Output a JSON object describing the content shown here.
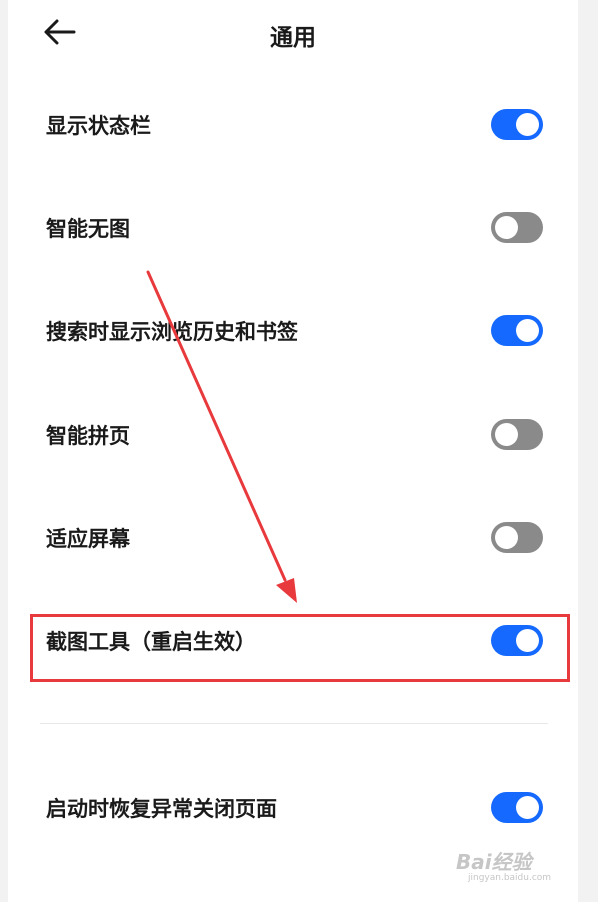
{
  "header": {
    "title": "通用",
    "back_icon": "arrow-left-icon"
  },
  "settings": [
    {
      "label": "显示状态栏",
      "enabled": true
    },
    {
      "label": "智能无图",
      "enabled": false
    },
    {
      "label": "搜索时显示浏览历史和书签",
      "enabled": true
    },
    {
      "label": "智能拼页",
      "enabled": false
    },
    {
      "label": "适应屏幕",
      "enabled": false
    },
    {
      "label": "截图工具（重启生效）",
      "enabled": true,
      "highlighted": true
    },
    {
      "label": "启动时恢复异常关闭页面",
      "enabled": true
    }
  ],
  "colors": {
    "toggle_on": "#1569ff",
    "toggle_off": "#8a8a8a",
    "annotation": "#e8393c"
  },
  "watermark": {
    "main": "Bai经验",
    "sub": "jingyan.baidu.com"
  }
}
